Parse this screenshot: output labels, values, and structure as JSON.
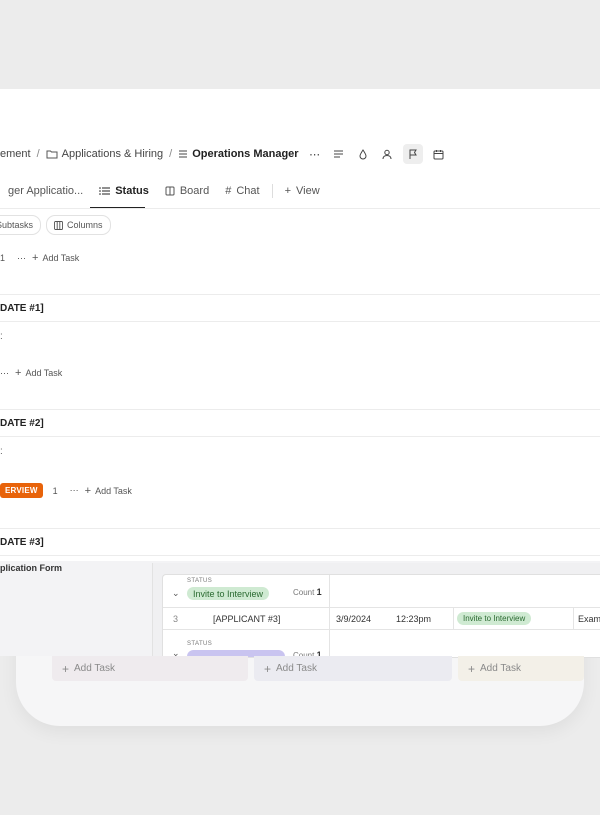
{
  "breadcrumb": {
    "items": [
      "ement",
      "Applications & Hiring",
      "Operations Manager"
    ],
    "more": "⋯"
  },
  "tabs": [
    {
      "label": "ger Applicatio..."
    },
    {
      "label": "Status"
    },
    {
      "label": "Board"
    },
    {
      "label": "Chat"
    },
    {
      "label": "View"
    }
  ],
  "toolbar": {
    "subtasks": "Subtasks",
    "columns": "Columns"
  },
  "rows": {
    "count1": "1",
    "add_task": "Add Task",
    "count_interview": "1"
  },
  "groups": {
    "g1": "DATE #1]",
    "g2": "DATE #2]",
    "g3": "DATE #3]"
  },
  "badge": {
    "interview": "ERVIEW"
  },
  "bottom": {
    "app_form": "plication Form",
    "status_label": "STATUS",
    "status_invite": "Invite to Interview",
    "count_label": "Count",
    "count_value": "1",
    "count_value_2": "1",
    "row": {
      "index": "3",
      "applicant": "[APPLICANT #3]",
      "date": "3/9/2024",
      "time": "12:23pm",
      "status": "Invite to Interview",
      "trailing": "Exam"
    }
  },
  "add_tasks": [
    "Add Task",
    "Add Task",
    "Add Task"
  ],
  "colors": {
    "accent_orange": "#e8630a",
    "status_green": "#cfead2",
    "status_purple": "#c9c4f0"
  }
}
